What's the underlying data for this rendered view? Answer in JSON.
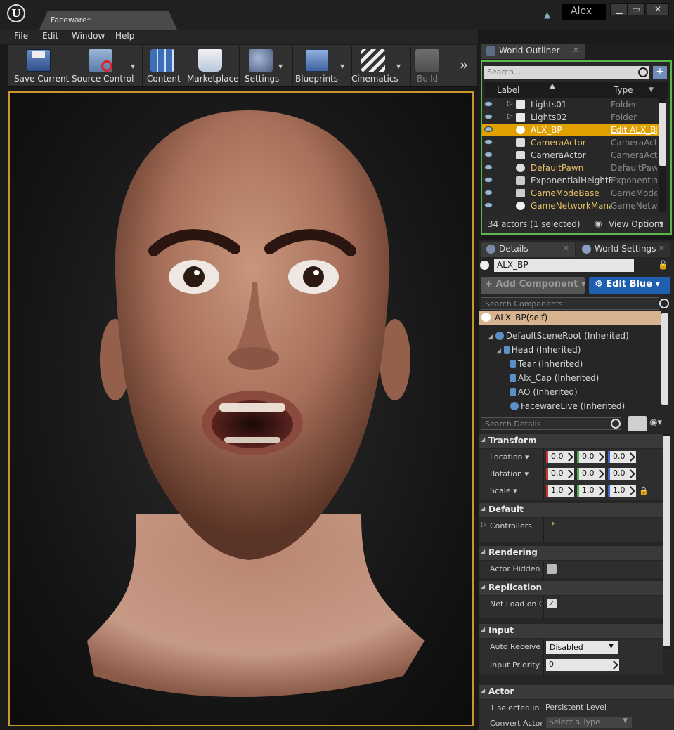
{
  "window": {
    "tab_title": "Faceware*",
    "user": "Alex",
    "minimize": "▁",
    "maximize": "▭",
    "close": "✕"
  },
  "menu": [
    "File",
    "Edit",
    "Window",
    "Help"
  ],
  "toolbar": {
    "buttons": [
      {
        "label": "Save Current",
        "icon": "floppy-disk-icon"
      },
      {
        "label": "Source Control",
        "icon": "source-control-icon"
      },
      {
        "label": "Content",
        "icon": "content-grid-icon"
      },
      {
        "label": "Marketplace",
        "icon": "marketplace-bag-icon"
      },
      {
        "label": "Settings",
        "icon": "settings-cubes-icon"
      },
      {
        "label": "Blueprints",
        "icon": "blueprints-icon"
      },
      {
        "label": "Cinematics",
        "icon": "clapperboard-icon"
      },
      {
        "label": "Build",
        "icon": "build-blocks-icon"
      }
    ],
    "overflow": "»"
  },
  "outliner": {
    "tab_label": "World Outliner",
    "search_placeholder": "Search...",
    "col_label": "Label",
    "col_type": "Type",
    "rows": [
      {
        "label": "Lights01",
        "type": "Folder"
      },
      {
        "label": "Lights02",
        "type": "Folder"
      },
      {
        "label": "ALX_BP",
        "type": "Edit ALX_BP"
      },
      {
        "label": "CameraActor",
        "type": "CameraActor"
      },
      {
        "label": "CameraActor",
        "type": "CameraActor"
      },
      {
        "label": "DefaultPawn",
        "type": "DefaultPawn"
      },
      {
        "label": "ExponentialHeightFog",
        "type": "ExponentialHeightFog"
      },
      {
        "label": "GameModeBase",
        "type": "GameModeBase"
      },
      {
        "label": "GameNetworkManager",
        "type": "GameNetworkManager"
      }
    ],
    "status": "34 actors (1 selected)",
    "view_options": "View Options"
  },
  "details": {
    "tab_label": "Details",
    "world_settings_label": "World Settings",
    "actor_name": "ALX_BP",
    "add_component": "+ Add Component",
    "edit_blueprint": "Edit Blue",
    "search_components": "Search Components",
    "self_label": "ALX_BP(self)",
    "components": [
      "DefaultSceneRoot (Inherited)",
      "Head (Inherited)",
      "Tear (Inherited)",
      "Alx_Cap (Inherited)",
      "AO (Inherited)",
      "FacewareLive (Inherited)"
    ],
    "search_details": "Search Details",
    "transform": {
      "title": "Transform",
      "location_label": "Location",
      "rotation_label": "Rotation",
      "scale_label": "Scale",
      "location": [
        "0.0",
        "0.0",
        "0.0"
      ],
      "rotation": [
        "0.0",
        "0.0",
        "0.0"
      ],
      "scale": [
        "1.0",
        "1.0",
        "1.0"
      ]
    },
    "default": {
      "title": "Default",
      "controllers_label": "Controllers"
    },
    "rendering": {
      "title": "Rendering",
      "hidden_label": "Actor Hidden In Game"
    },
    "replication": {
      "title": "Replication",
      "net_load_label": "Net Load on Client"
    },
    "input": {
      "title": "Input",
      "auto_receive_label": "Auto Receive Input",
      "auto_receive_value": "Disabled",
      "priority_label": "Input Priority",
      "priority_value": "0"
    },
    "actor": {
      "title": "Actor",
      "selected_label": "1 selected in",
      "selected_value": "Persistent Level",
      "convert_label": "Convert Actor",
      "convert_value": "Select a Type"
    }
  },
  "colors": {
    "accent": "#c8962a",
    "selection": "#e0a000",
    "edit_blueprint": "#1f5fb0"
  }
}
